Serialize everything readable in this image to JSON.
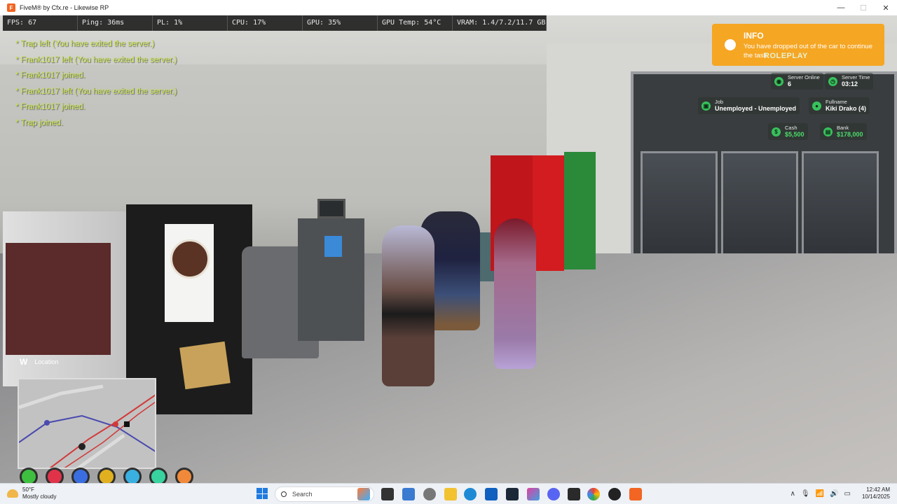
{
  "window": {
    "title": "FiveM® by Cfx.re - Likewise RP",
    "minimize": "—",
    "maximize": "☐",
    "close": "✕"
  },
  "perf": [
    "FPS: 67",
    "Ping: 36ms",
    "PL: 1%",
    "CPU: 17%",
    "GPU: 35%",
    "GPU Temp: 54°C",
    "VRAM: 1.4/7.2/11.7 GB"
  ],
  "chat": [
    "* Trap left (You have exited the server.)",
    "* Frank1017 left (You have exited the server.)",
    "* Frank1017 joined.",
    "* Frank1017 left (You have exited the server.)",
    "* Frank1017 joined.",
    "* Trap joined."
  ],
  "notification": {
    "title": "INFO",
    "text": "You have dropped out of the car to continue the task."
  },
  "brand": "ROLEPLAY",
  "stats": {
    "server_online": {
      "label": "Server Online",
      "value": "6"
    },
    "server_time": {
      "label": "Server Time",
      "value": "03:12"
    },
    "job": {
      "label": "Job",
      "value": "Unemployed - Unemployed"
    },
    "fullname": {
      "label": "Fullname",
      "value": "Kiki Drako (4)"
    },
    "cash": {
      "label": "Cash",
      "value": "$5,500"
    },
    "bank": {
      "label": "Bank",
      "value": "$178,000"
    }
  },
  "location": {
    "compass": "W",
    "label": "Location"
  },
  "hud_icons": [
    {
      "name": "health-icon",
      "color": "#3fbf3f"
    },
    {
      "name": "heart-icon",
      "color": "#e0334a"
    },
    {
      "name": "shield-icon",
      "color": "#3a6ee0"
    },
    {
      "name": "hunger-icon",
      "color": "#e0b020"
    },
    {
      "name": "thirst-icon",
      "color": "#3ab0e0"
    },
    {
      "name": "stamina-icon",
      "color": "#38d39f"
    },
    {
      "name": "stress-icon",
      "color": "#f08a3a"
    }
  ],
  "taskbar": {
    "weather_temp": "50°F",
    "weather_cond": "Mostly cloudy",
    "search_placeholder": "Search",
    "time": "12:42 AM",
    "date": "10/14/2025",
    "tray_up": "∧"
  },
  "colors": {
    "chat_text": "#c9e84a",
    "info_bg": "#f5a623",
    "hud_green": "#38c15c"
  }
}
